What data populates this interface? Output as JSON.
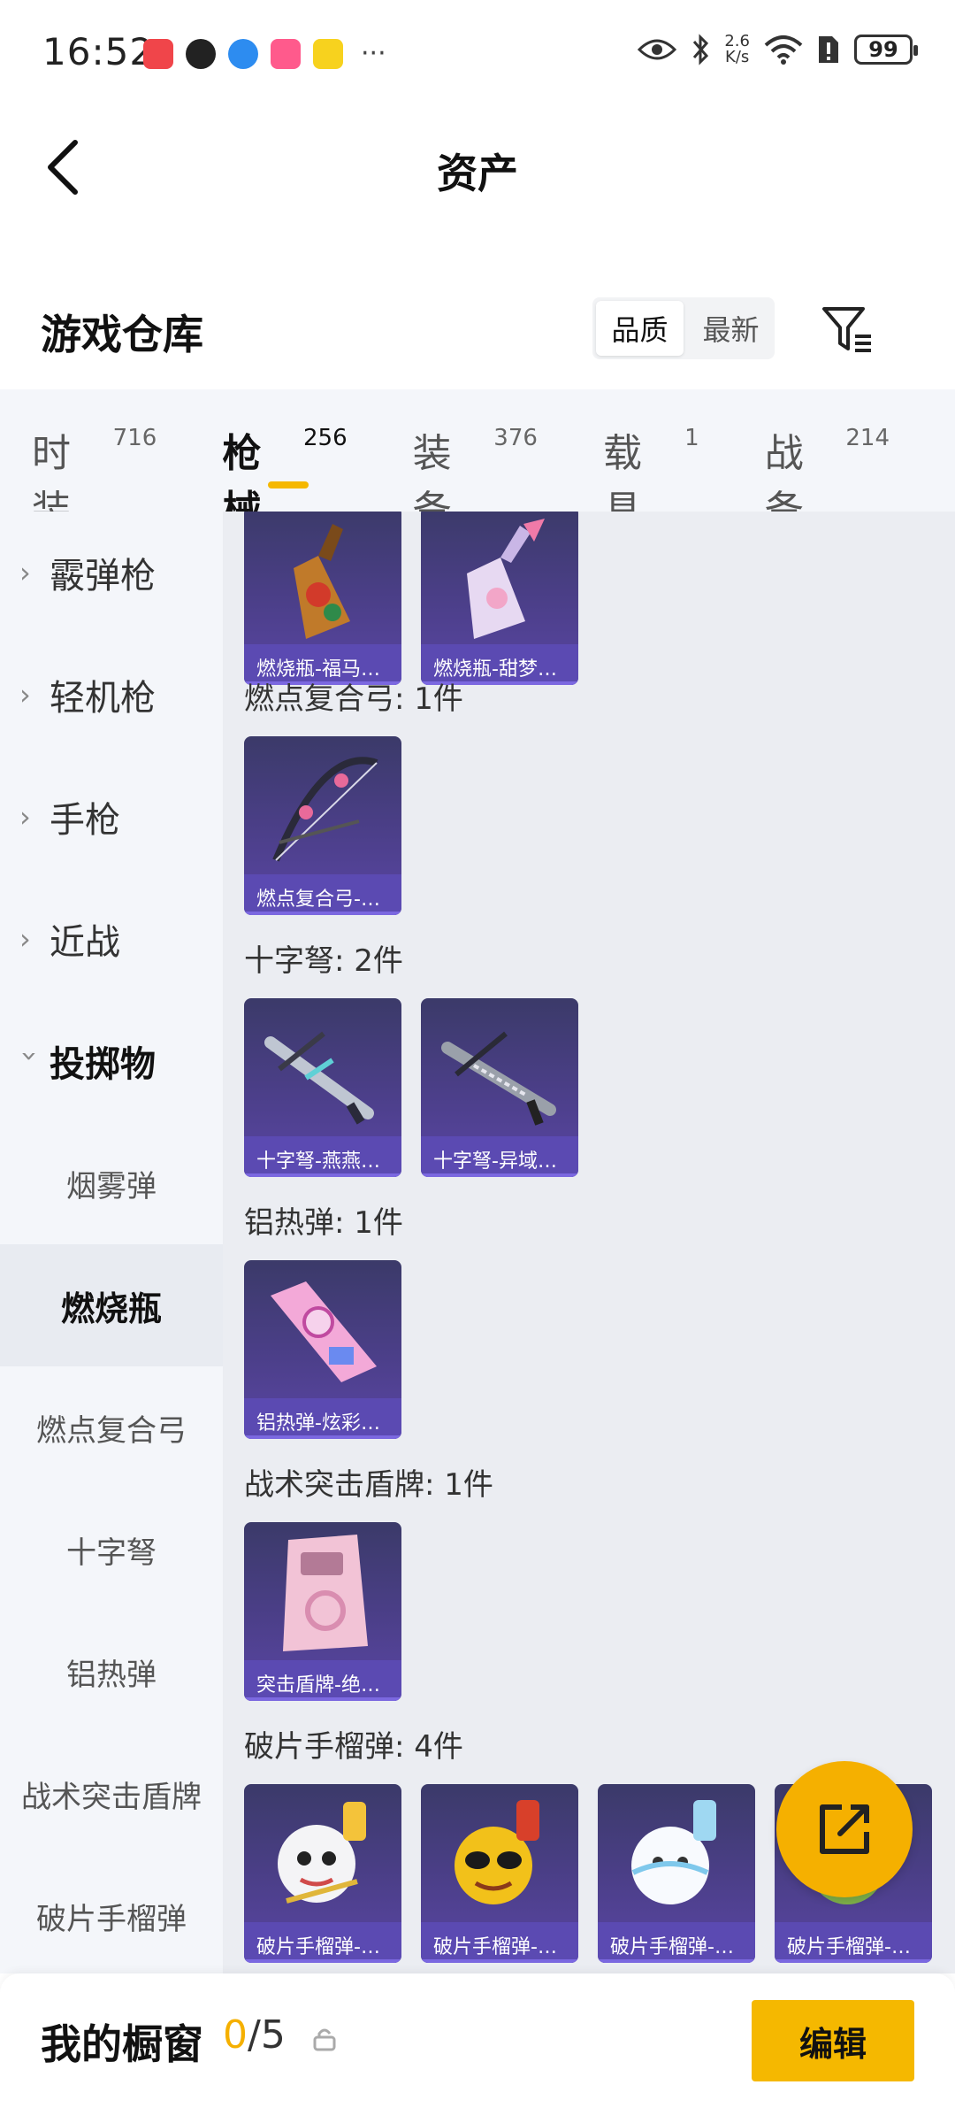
{
  "status_bar": {
    "time": "16:52",
    "net_speed_value": "2.6",
    "net_speed_unit": "K/s",
    "battery": "99"
  },
  "header": {
    "title": "资产"
  },
  "warehouse": {
    "title": "游戏仓库",
    "sort_options": [
      "品质",
      "最新"
    ]
  },
  "tabs": [
    {
      "label": "时装",
      "count": "716"
    },
    {
      "label": "枪械",
      "count": "256"
    },
    {
      "label": "装备",
      "count": "376"
    },
    {
      "label": "载具",
      "count": "1"
    },
    {
      "label": "战备",
      "count": "214"
    }
  ],
  "sidebar": {
    "categories": [
      "霰弹枪",
      "轻机枪",
      "手枪",
      "近战",
      "投掷物"
    ],
    "subcategories": [
      "烟雾弹",
      "燃烧瓶",
      "燃点复合弓",
      "十字弩",
      "铝热弹",
      "战术突击盾牌",
      "破片手榴弹"
    ]
  },
  "content": {
    "groups": [
      {
        "title": "",
        "items": [
          "燃烧瓶-福马…",
          "燃烧瓶-甜梦…"
        ]
      },
      {
        "title": "燃点复合弓: 1件",
        "items": [
          "燃点复合弓-…"
        ]
      },
      {
        "title": "十字弩: 2件",
        "items": [
          "十字弩-燕燕…",
          "十字弩-异域…"
        ]
      },
      {
        "title": "铝热弹: 1件",
        "items": [
          "铝热弹-炫彩…"
        ]
      },
      {
        "title": "战术突击盾牌: 1件",
        "items": [
          "突击盾牌-绝…"
        ]
      },
      {
        "title": "破片手榴弹: 4件",
        "items": [
          "破片手榴弹-…",
          "破片手榴弹-…",
          "破片手榴弹-…",
          "破片手榴弹-…"
        ]
      }
    ]
  },
  "bottom_bar": {
    "title": "我的橱窗",
    "used": "0",
    "total": "/5",
    "edit_label": "编辑"
  },
  "colors": {
    "accent": "#f5b800",
    "card_caption": "#5b4ab2"
  }
}
